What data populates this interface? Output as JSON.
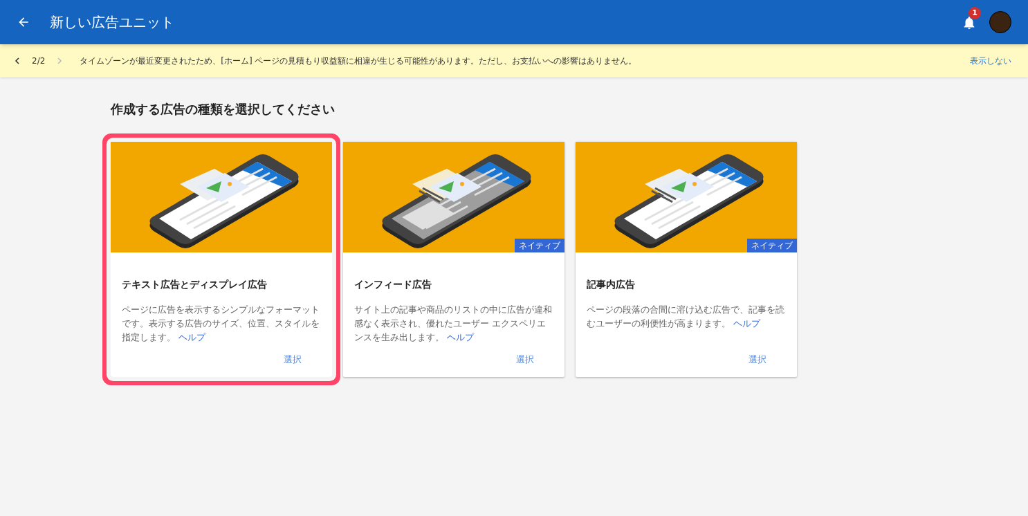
{
  "app_bar": {
    "title": "新しい広告ユニット",
    "notification_count": "1"
  },
  "banner": {
    "counter": "2/2",
    "message": "タイムゾーンが最近変更されたため、[ホーム] ページの見積もり収益額に相違が生じる可能性があります。ただし、お支払いへの影響はありません。",
    "dismiss": "表示しない"
  },
  "heading": "作成する広告の種類を選択してください",
  "cards": [
    {
      "title": "テキスト広告とディスプレイ広告",
      "description": "ページに広告を表示するシンプルなフォーマットです。表示する広告のサイズ、位置、スタイルを指定します。",
      "help": "ヘルプ",
      "action": "選択",
      "selected": true
    },
    {
      "title": "インフィード広告",
      "badge": "ネイティブ",
      "description": "サイト上の記事や商品のリストの中に広告が違和感なく表示され、優れたユーザー エクスペリエンスを生み出します。",
      "help": "ヘルプ",
      "action": "選択",
      "selected": false
    },
    {
      "title": "記事内広告",
      "badge": "ネイティブ",
      "description": "ページの段落の合間に溶け込む広告で、記事を読むユーザーの利便性が高まります。",
      "help": "ヘルプ",
      "action": "選択",
      "selected": false
    }
  ]
}
